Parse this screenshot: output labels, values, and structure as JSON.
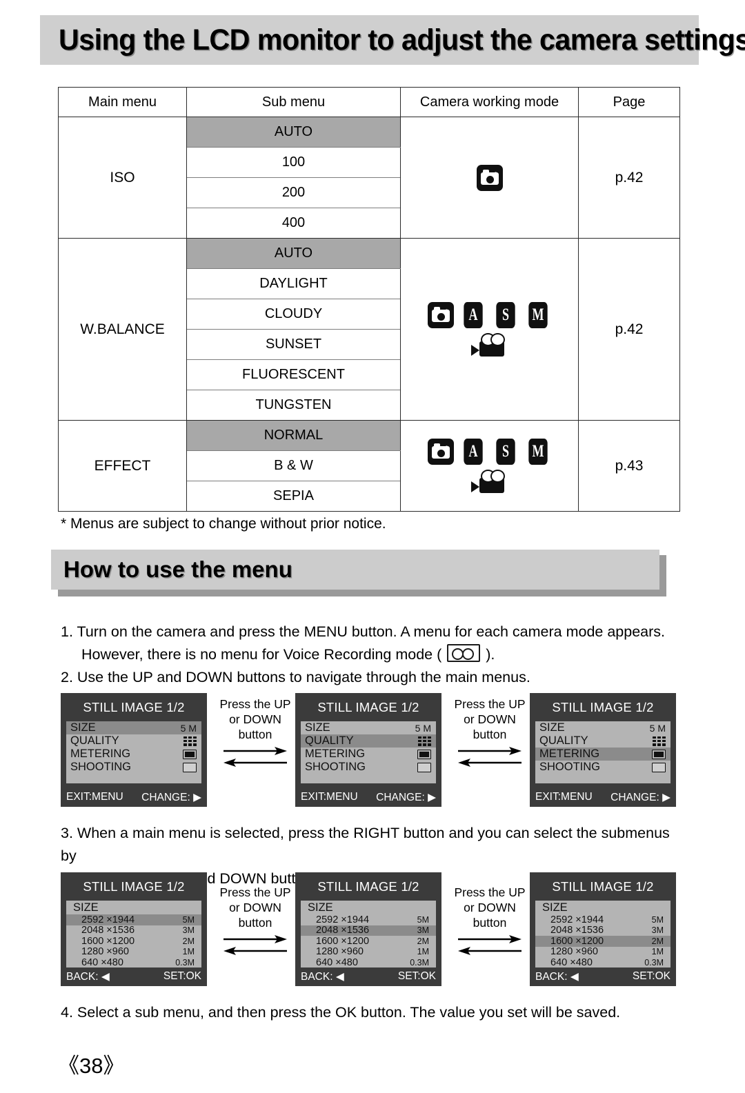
{
  "header": {
    "title": "Using the LCD monitor to adjust the camera settings"
  },
  "table": {
    "headers": [
      "Main menu",
      "Sub menu",
      "Camera working mode",
      "Page"
    ],
    "rows": [
      {
        "main": "ISO",
        "submenus": [
          "AUTO",
          "100",
          "200",
          "400"
        ],
        "selected_index": 0,
        "modes": {
          "camera": "camera-icon",
          "badges": [],
          "movie": false
        },
        "page": "p.42"
      },
      {
        "main": "W.BALANCE",
        "submenus": [
          "AUTO",
          "DAYLIGHT",
          "CLOUDY",
          "SUNSET",
          "FLUORESCENT",
          "TUNGSTEN"
        ],
        "selected_index": 0,
        "modes": {
          "camera": "camera-icon",
          "badges": [
            "A",
            "S",
            "M"
          ],
          "movie": true
        },
        "page": "p.42"
      },
      {
        "main": "EFFECT",
        "submenus": [
          "NORMAL",
          "B & W",
          "SEPIA"
        ],
        "selected_index": 0,
        "modes": {
          "camera": "camera-icon",
          "badges": [
            "A",
            "S",
            "M"
          ],
          "movie": true
        },
        "page": "p.43"
      }
    ]
  },
  "note": "* Menus are subject to change without prior notice.",
  "section": {
    "heading": "How to use the menu"
  },
  "steps": {
    "step1_line1": "1. Turn on the camera and press the MENU button. A menu for each camera mode appears.",
    "step1_line2a": "However, there is no menu for Voice Recording mode (",
    "step1_line2b": ").",
    "step2": "2. Use the UP and DOWN buttons to navigate through the main menus.",
    "step3_line1": "3. When a main menu is selected, press the RIGHT button and you can select the submenus by",
    "step3_line2": "pressing the UP and DOWN button.",
    "step4": "4. Select a sub menu, and then press the OK button. The value you set will be saved."
  },
  "press_caption": {
    "line1": "Press the UP",
    "line2": "or DOWN",
    "line3": "button"
  },
  "lcd_main": {
    "title": "STILL IMAGE 1/2",
    "items": [
      {
        "label": "SIZE",
        "value": "5 M",
        "icon": "text"
      },
      {
        "label": "QUALITY",
        "value": "",
        "icon": "dots-icon"
      },
      {
        "label": "METERING",
        "value": "",
        "icon": "meter-icon"
      },
      {
        "label": "SHOOTING",
        "value": "",
        "icon": "shoot-icon"
      }
    ],
    "footer_left": "EXIT:MENU",
    "footer_right": "CHANGE: ▶",
    "screens": [
      {
        "selected_index": 0
      },
      {
        "selected_index": 1
      },
      {
        "selected_index": 2
      }
    ]
  },
  "lcd_sub": {
    "title": "STILL IMAGE 1/2",
    "head": "SIZE",
    "options": [
      {
        "res": "2592 ×1944",
        "mp": "5M"
      },
      {
        "res": "2048 ×1536",
        "mp": "3M"
      },
      {
        "res": "1600 ×1200",
        "mp": "2M"
      },
      {
        "res": "1280 ×960",
        "mp": "1M"
      },
      {
        "res": "640 ×480",
        "mp": "0.3M"
      }
    ],
    "footer_left": "BACK: ◀",
    "footer_right": "SET:OK",
    "screens": [
      {
        "selected_index": 0
      },
      {
        "selected_index": 1
      },
      {
        "selected_index": 2
      }
    ]
  },
  "page_number": "《38》",
  "colors": {
    "banner_gray": "#cfcfcf",
    "row_highlight": "#a8a8a8",
    "lcd_bg": "#3b3b3b",
    "lcd_panel": "#b4b4b4",
    "lcd_selected": "#8b8b8b"
  }
}
